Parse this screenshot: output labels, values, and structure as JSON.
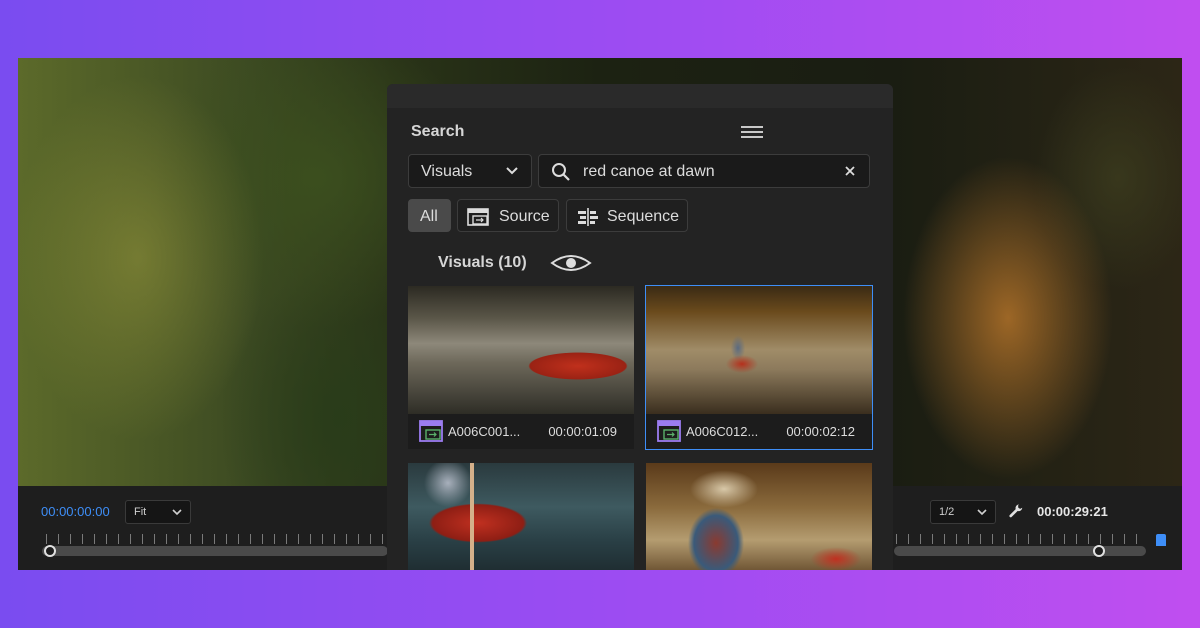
{
  "viewer": {
    "timecode_current": "00:00:00:00",
    "timecode_total": "00:00:29:21",
    "zoom": "Fit",
    "resolution": "1/2",
    "playhead_fraction": 0.0,
    "out_handle_fraction": 0.79
  },
  "search_panel": {
    "title": "Search",
    "scope_select": "Visuals",
    "query": "red canoe at dawn",
    "filters": [
      {
        "label": "All",
        "active": true
      },
      {
        "label": "Source",
        "active": false,
        "icon": "source-clip-icon"
      },
      {
        "label": "Sequence",
        "active": false,
        "icon": "sequence-icon"
      }
    ],
    "section_label": "Visuals (10)",
    "results": [
      {
        "name": "A006C001...",
        "duration": "00:00:01:09",
        "selected": false
      },
      {
        "name": "A006C012...",
        "duration": "00:00:02:12",
        "selected": true
      },
      {
        "name": "",
        "duration": "",
        "selected": false
      },
      {
        "name": "",
        "duration": "",
        "selected": false
      }
    ]
  },
  "colors": {
    "accent": "#3e8ef7",
    "panel_bg": "#232323",
    "clip_icon": "#9b7cf0"
  }
}
